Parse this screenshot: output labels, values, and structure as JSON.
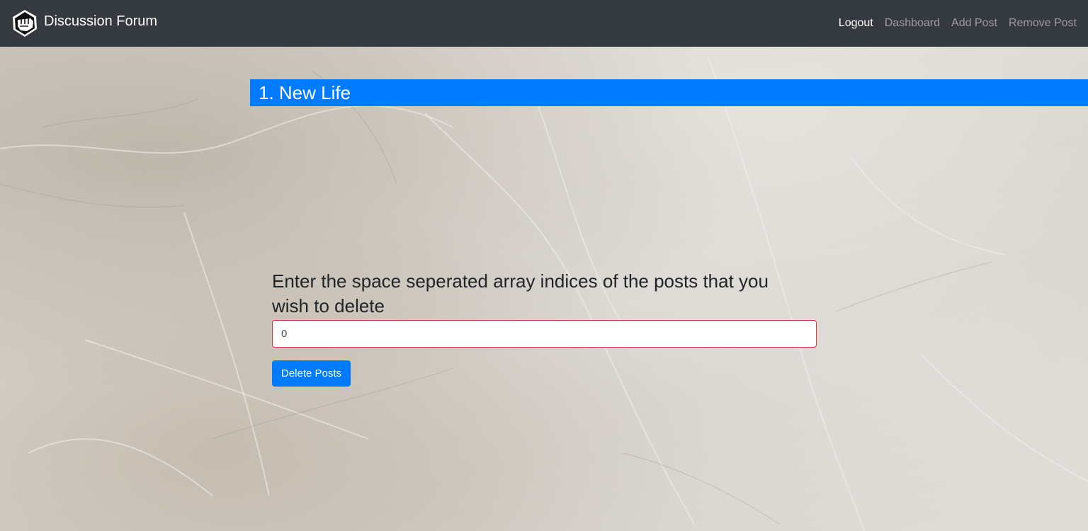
{
  "navbar": {
    "brand_text": "Discussion Forum",
    "logo_icon": "fist-logo-icon",
    "links": [
      {
        "label": "Logout",
        "active": true
      },
      {
        "label": "Dashboard",
        "active": false
      },
      {
        "label": "Add Post",
        "active": false
      },
      {
        "label": "Remove Post",
        "active": false
      }
    ]
  },
  "post": {
    "title": "1. New Life"
  },
  "form": {
    "label": "Enter the space seperated array indices of the posts that you wish to delete",
    "input_value": "0",
    "submit_label": "Delete Posts"
  },
  "colors": {
    "navbar_bg": "#343a40",
    "accent": "#007bff",
    "input_border_invalid": "#dc3545"
  }
}
